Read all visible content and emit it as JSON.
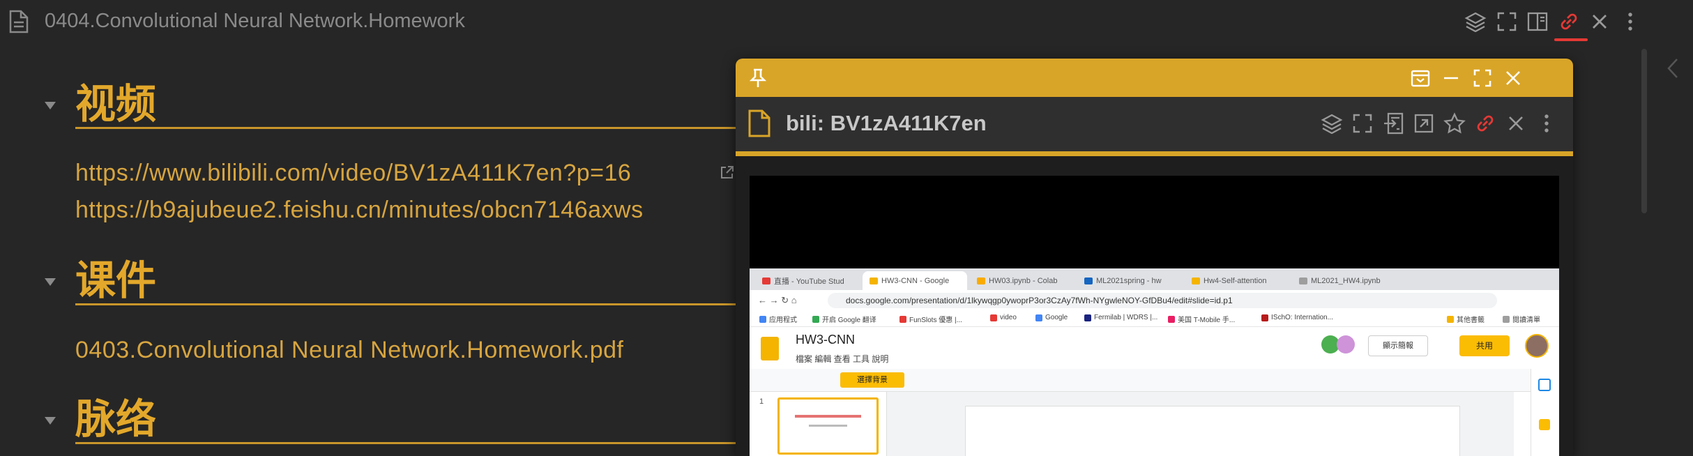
{
  "note": {
    "title": "0404.Convolutional Neural Network.Homework",
    "sections": [
      {
        "heading": "视频",
        "links": [
          "https://www.bilibili.com/video/BV1zA411K7en?p=16",
          "https://b9ajubeue2.feishu.cn/minutes/obcn7146axws"
        ]
      },
      {
        "heading": "课件",
        "links": [
          "0403.Convolutional Neural Network.Homework.pdf"
        ]
      },
      {
        "heading": "脉络",
        "links": []
      }
    ]
  },
  "top_icons": [
    "layers-icon",
    "fullscreen-icon",
    "split-view-icon",
    "link-icon",
    "close-icon",
    "more-vertical-icon"
  ],
  "float_window": {
    "title": "bili: BV1zA411K7en",
    "titlebar_icons": [
      "pin-icon",
      "archive-icon",
      "minimize-icon",
      "maximize-icon",
      "close-icon"
    ],
    "header_icons": [
      "layers-icon",
      "fullscreen-icon",
      "export-icon",
      "open-external-icon",
      "star-icon",
      "link-icon",
      "close-icon",
      "more-vertical-icon"
    ]
  },
  "video": {
    "browser_tabs": [
      "直播 - YouTube Stud",
      "HW3-CNN - Google",
      "HW03.ipynb - Colab",
      "ML2021spring - hw",
      "Hw4-Self-attention",
      "ML2021_HW4.ipynb"
    ],
    "url": "docs.google.com/presentation/d/1lkywqgp0ywoprP3or3CzAy7fWh-NYgwleNOY-GfDBu4/edit#slide=id.p1",
    "bookmarks": [
      "应用程式",
      "开启 Google 翻译",
      "FunSlots 優惠 |...",
      "video",
      "Google",
      "Fermilab | WDRS |...",
      "美国 T-Mobile 手...",
      "ISchO: Internation...",
      "其他書籤",
      "閱讀清單"
    ],
    "slides_name": "HW3-CNN",
    "slides_menu": "檔案 編輯 查看 工具 說明",
    "present_label": "顯示簡報",
    "share_label": "共用",
    "background_label": "選擇背景",
    "slide_number": "1"
  },
  "colors": {
    "accent": "#e3a82b",
    "background": "#262626",
    "link": "#d7a540",
    "active_link_icon": "#e53935"
  }
}
